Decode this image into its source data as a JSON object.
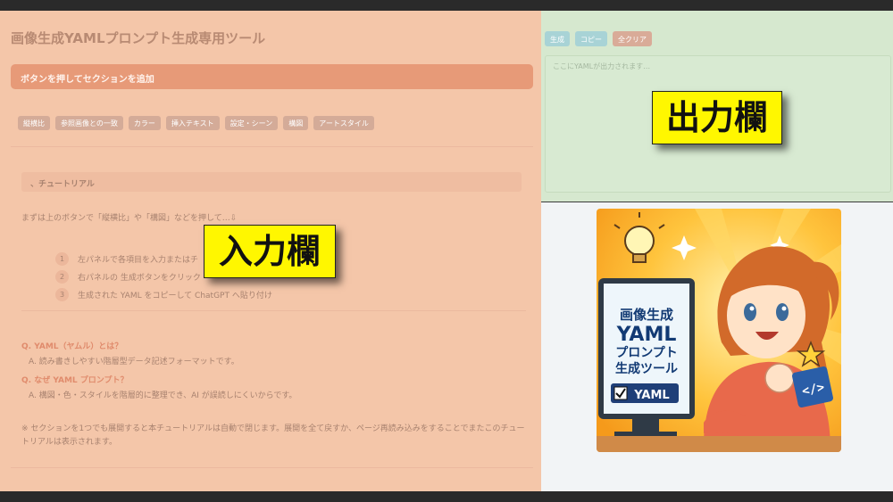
{
  "app_title": "画像生成YAMLプロンプト生成専用ツール",
  "add_banner": "ボタンを押してセクションを追加",
  "section_buttons": [
    "縦横比",
    "参照画像との一致",
    "カラー",
    "挿入テキスト",
    "設定・シーン",
    "構図",
    "アートスタイル"
  ],
  "tutorial": {
    "header": "、チュートリアル",
    "intro": "まずは上のボタンで「縦横比」や「構図」などを押して…⇩",
    "steps": [
      {
        "num": "1",
        "text": "左パネルで各項目を入力またはチ"
      },
      {
        "num": "2",
        "text": "右パネルの 生成ボタンをクリック"
      },
      {
        "num": "3",
        "text": "生成された YAML をコピーして ChatGPT へ貼り付け"
      }
    ],
    "faq": [
      {
        "q": "Q. YAML（ヤムル）とは？",
        "a": "A. 読み書きしやすい階層型データ記述フォーマットです。"
      },
      {
        "q": "Q. なぜ YAML プロンプト？",
        "a": "A. 構図・色・スタイルを階層的に整理でき、AI が誤読しにくいからです。"
      }
    ],
    "note": "※ セクションを1つでも展開すると本チュートリアルは自動で閉じます。展開を全て戻すか、ページ再読み込みをすることでまたこのチュートリアルは表示されます。"
  },
  "output": {
    "buttons": [
      {
        "label": "生成",
        "color": "#a8d3d6"
      },
      {
        "label": "コピー",
        "color": "#a8d3d6"
      },
      {
        "label": "全クリア",
        "color": "#d9ab98"
      }
    ],
    "placeholder": "ここにYAMLが出力されます…"
  },
  "overlays": {
    "input_label": "入力欄",
    "output_label": "出力欄"
  },
  "illustration": {
    "sign_lines": [
      "画像生成",
      "YAML",
      "プロンプト",
      "生成ツール"
    ],
    "badge": "YAML",
    "code_icon": "</>"
  }
}
